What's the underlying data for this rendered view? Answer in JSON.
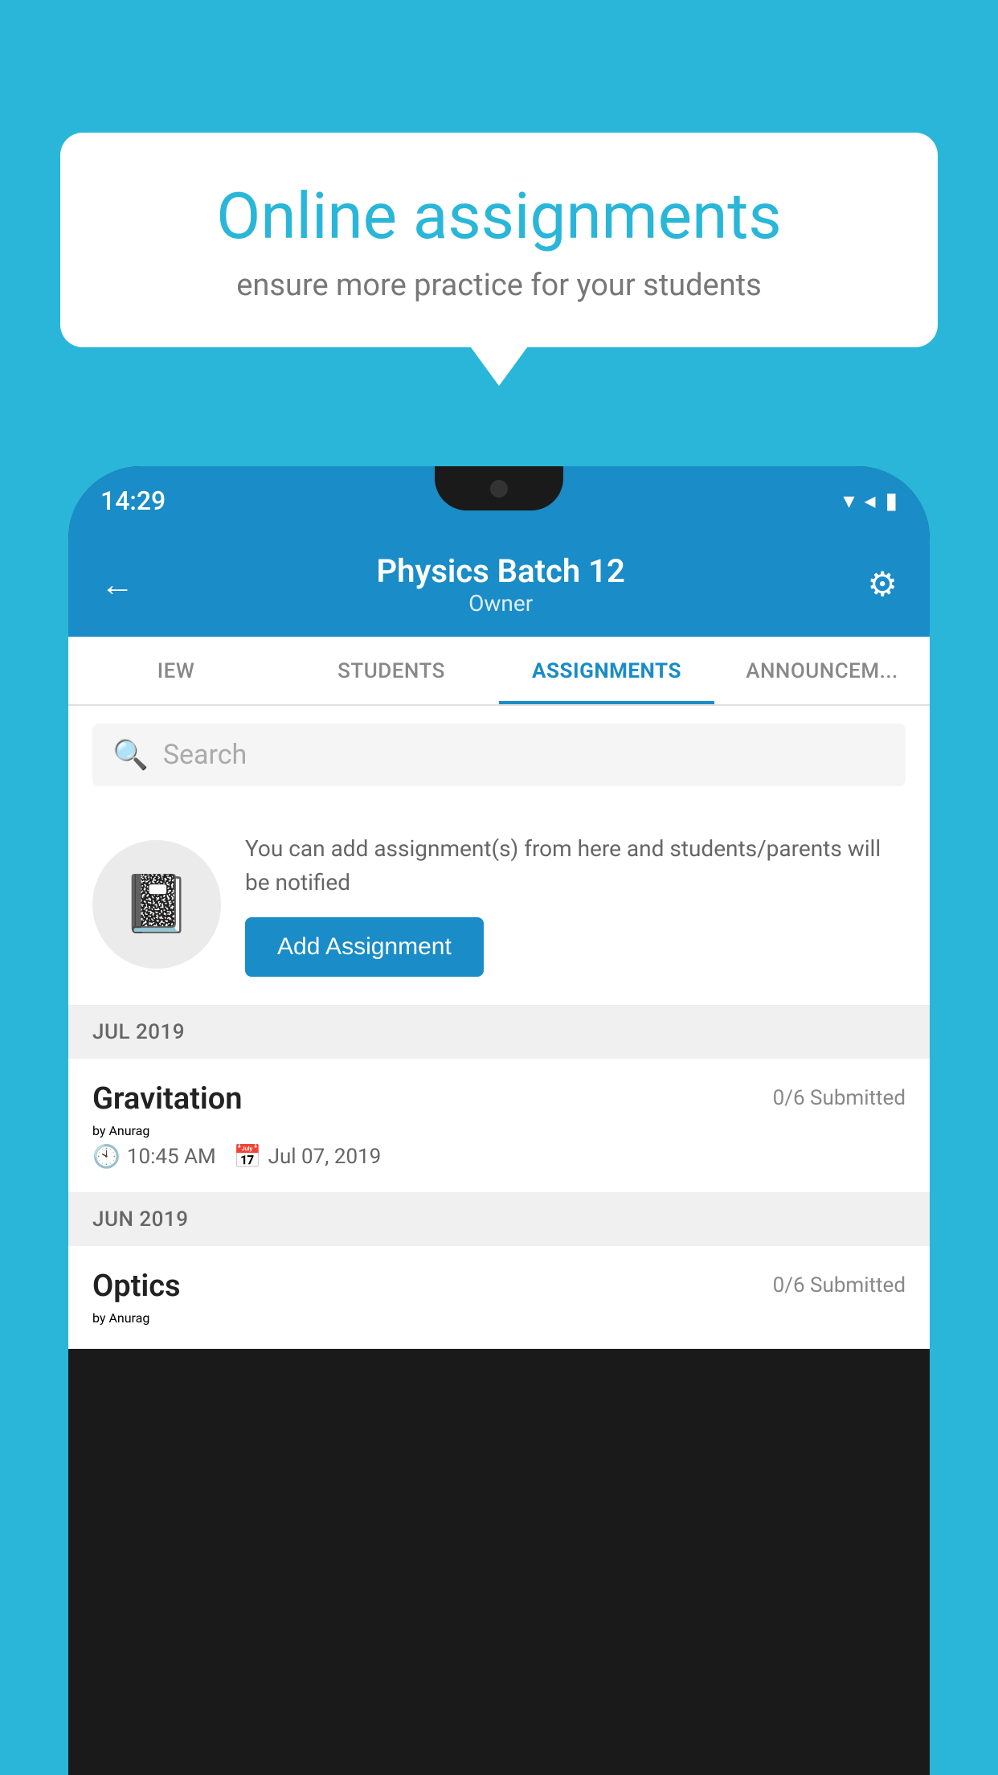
{
  "background_color": "#29B6D8",
  "speech_bubble": {
    "title": "Online assignments",
    "subtitle": "ensure more practice for your students"
  },
  "status_bar": {
    "time": "14:29",
    "wifi": "▼",
    "signal": "▲",
    "battery": "▮"
  },
  "header": {
    "title": "Physics Batch 12",
    "subtitle": "Owner",
    "back_label": "←",
    "settings_label": "⚙"
  },
  "tabs": [
    {
      "label": "IEW",
      "active": false
    },
    {
      "label": "STUDENTS",
      "active": false
    },
    {
      "label": "ASSIGNMENTS",
      "active": true
    },
    {
      "label": "ANNOUNCEM...",
      "active": false
    }
  ],
  "search": {
    "placeholder": "Search"
  },
  "info_card": {
    "description": "You can add assignment(s) from here and students/parents will be notified",
    "button_label": "Add Assignment"
  },
  "sections": [
    {
      "month_label": "JUL 2019",
      "assignments": [
        {
          "name": "Gravitation",
          "submitted": "0/6 Submitted",
          "by": "by Anurag",
          "time": "10:45 AM",
          "date": "Jul 07, 2019"
        }
      ]
    },
    {
      "month_label": "JUN 2019",
      "assignments": [
        {
          "name": "Optics",
          "submitted": "0/6 Submitted",
          "by": "by Anurag",
          "time": "",
          "date": ""
        }
      ]
    }
  ]
}
